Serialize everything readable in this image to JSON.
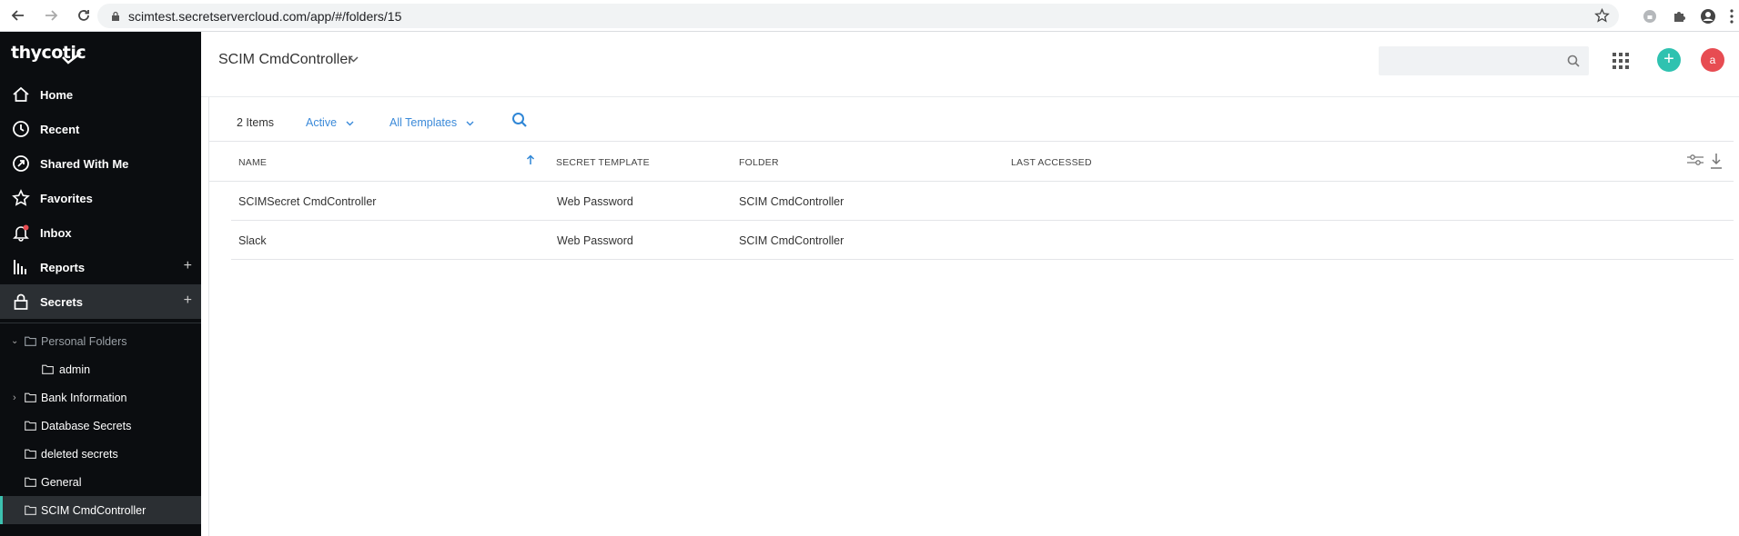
{
  "browser": {
    "url": "scimtest.secretservercloud.com/app/#/folders/15"
  },
  "sidebar": {
    "logo": "thycotic",
    "nav": [
      {
        "label": "Home",
        "icon": "home-icon"
      },
      {
        "label": "Recent",
        "icon": "clock-icon"
      },
      {
        "label": "Shared With Me",
        "icon": "share-icon"
      },
      {
        "label": "Favorites",
        "icon": "star-icon"
      },
      {
        "label": "Inbox",
        "icon": "bell-icon"
      },
      {
        "label": "Reports",
        "icon": "reports-icon"
      },
      {
        "label": "Secrets",
        "icon": "lock-icon"
      }
    ],
    "folders": [
      {
        "label": "Personal Folders"
      },
      {
        "label": "admin"
      },
      {
        "label": "Bank Information"
      },
      {
        "label": "Database Secrets"
      },
      {
        "label": "deleted secrets"
      },
      {
        "label": "General"
      },
      {
        "label": "SCIM CmdController"
      }
    ],
    "plus": "+"
  },
  "header": {
    "title": "SCIM CmdController",
    "search_placeholder": "",
    "avatar_letter": "a",
    "add_label": "+"
  },
  "toolbar": {
    "count": "2 Items",
    "status_filter": "Active",
    "template_filter": "All Templates"
  },
  "table": {
    "columns": [
      "NAME",
      "SECRET TEMPLATE",
      "FOLDER",
      "LAST ACCESSED"
    ],
    "rows": [
      {
        "name": "SCIMSecret CmdController",
        "template": "Web Password",
        "folder": "SCIM CmdController",
        "last_accessed": ""
      },
      {
        "name": "Slack",
        "template": "Web Password",
        "folder": "SCIM CmdController",
        "last_accessed": ""
      }
    ]
  },
  "colors": {
    "sidebar_bg": "#0b0d10",
    "accent": "#2fc2b0",
    "link": "#3b8ad9",
    "avatar": "#e74c52"
  }
}
